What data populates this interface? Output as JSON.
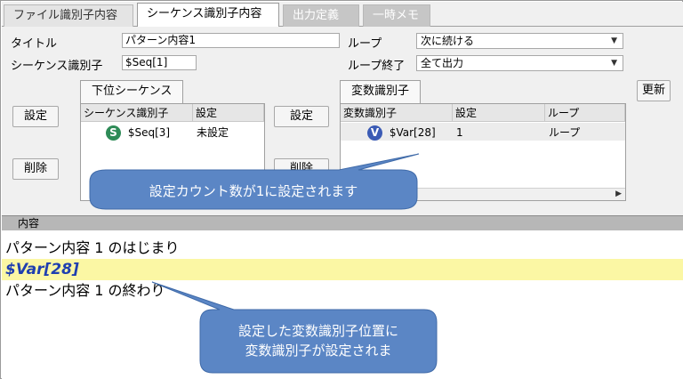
{
  "tabs": [
    "ファイル識別子内容",
    "シーケンス識別子内容",
    "出力定義",
    "一時メモ"
  ],
  "fields": {
    "title_label": "タイトル",
    "title_value": "パターン内容1",
    "seq_id_label": "シーケンス識別子",
    "seq_id_value": "$Seq[1]",
    "loop_label": "ループ",
    "loop_value": "次に続ける",
    "loop_end_label": "ループ終了",
    "loop_end_value": "全て出力"
  },
  "buttons": {
    "update": "更新",
    "set_left": "設定",
    "delete_left": "削除",
    "set_mid": "設定",
    "delete_mid": "削除"
  },
  "sub_sequence": {
    "tab_label": "下位シーケンス",
    "columns": [
      "シーケンス識別子",
      "設定"
    ],
    "rows": [
      {
        "badge": "S",
        "id": "$Seq[3]",
        "setting": "未設定"
      }
    ]
  },
  "variables": {
    "tab_label": "変数識別子",
    "columns": [
      "変数識別子",
      "設定",
      "ループ"
    ],
    "rows": [
      {
        "badge": "V",
        "id": "$Var[28]",
        "setting": "1",
        "loop": "ループ"
      }
    ]
  },
  "content": {
    "header": "内容",
    "lines": [
      "パターン内容 1 のはじまり",
      "$Var[28]",
      "パターン内容 1 の終わり"
    ]
  },
  "callouts": {
    "top": "設定カウント数が1に設定されます",
    "bottom_line1": "設定した変数識別子位置に",
    "bottom_line2": "変数識別子が設定されま"
  },
  "colors": {
    "seq_badge": "#2e8b57",
    "var_badge": "#3b5bb5",
    "callout_fill": "#5b86c5",
    "highlight": "#fbf7a4",
    "variable_text": "#1f3fb0"
  },
  "icons": [
    "chevron-down-icon",
    "scroll-left-icon",
    "scroll-right-icon"
  ]
}
